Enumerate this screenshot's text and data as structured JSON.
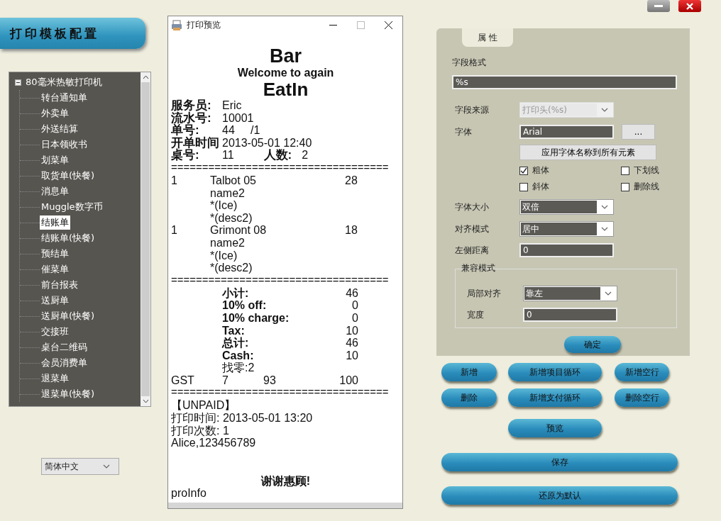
{
  "banner": {
    "title": "打印模板配置"
  },
  "tree": {
    "label": "80毫米热敏打印机",
    "expanded": true,
    "children": [
      {
        "label": "转台通知单",
        "selected": false
      },
      {
        "label": "外卖单",
        "selected": false
      },
      {
        "label": "外送结算",
        "selected": false
      },
      {
        "label": "日本领收书",
        "selected": false
      },
      {
        "label": "划菜单",
        "selected": false
      },
      {
        "label": "取货单(快餐)",
        "selected": false
      },
      {
        "label": "消息单",
        "selected": false
      },
      {
        "label": "Muggle数字币",
        "selected": false
      },
      {
        "label": "结账单",
        "selected": true
      },
      {
        "label": "结账单(快餐)",
        "selected": false
      },
      {
        "label": "预结单",
        "selected": false
      },
      {
        "label": "催菜单",
        "selected": false
      },
      {
        "label": "前台报表",
        "selected": false
      },
      {
        "label": "送厨单",
        "selected": false
      },
      {
        "label": "送厨单(快餐)",
        "selected": false
      },
      {
        "label": "交接班",
        "selected": false
      },
      {
        "label": "桌台二维码",
        "selected": false
      },
      {
        "label": "会员消费单",
        "selected": false
      },
      {
        "label": "退菜单",
        "selected": false
      },
      {
        "label": "退菜单(快餐)",
        "selected": false
      }
    ]
  },
  "language": {
    "value": "简体中文"
  },
  "preview": {
    "title": "打印预览",
    "receipt": {
      "title": "Bar",
      "subtitle": "Welcome to again",
      "order_type": "EatIn",
      "info": [
        {
          "label": "服务员:",
          "value": "Eric"
        },
        {
          "label": "流水号:",
          "value": "10001"
        },
        {
          "label": "单号:",
          "value": "44     /1"
        },
        {
          "label": "开单时间",
          "value": "2013-05-01 12:40"
        },
        {
          "label": "桌号:",
          "value": "11",
          "extra_label": "人数:",
          "extra_value": "2"
        }
      ],
      "separator_1": "===================================",
      "items": [
        {
          "qty": "1",
          "name": "Talbot 05",
          "price": "28",
          "notes": [
            "name2",
            "*(Ice)",
            "*(desc2)"
          ]
        },
        {
          "qty": "1",
          "name": "Grimont 08",
          "price": "18",
          "notes": [
            "name2",
            "*(Ice)",
            "*(desc2)"
          ]
        }
      ],
      "separator_2": "===================================",
      "totals": [
        {
          "kind": "total",
          "label": "小计:",
          "value": "46"
        },
        {
          "kind": "total",
          "label": "10% off:",
          "value": "0"
        },
        {
          "kind": "total",
          "label": "10% charge:",
          "value": "0"
        },
        {
          "kind": "total",
          "label": "Tax:",
          "value": "10"
        },
        {
          "kind": "total",
          "label": "总计:",
          "value": "46"
        },
        {
          "kind": "total",
          "label": "Cash:",
          "value": "10"
        },
        {
          "kind": "note",
          "label": "找零:2"
        }
      ],
      "gst": [
        "GST",
        "7",
        "93",
        "100"
      ],
      "separator_3": "===================================",
      "footer": [
        "【UNPAID】",
        "打印时间: 2013-05-01 13:20",
        "打印次数: 1",
        "Alice,123456789"
      ],
      "thanks": "谢谢惠顾!",
      "pro_info": "proInfo"
    }
  },
  "properties": {
    "tab": "属 性",
    "field_format": {
      "label": "字段格式",
      "value": "%s"
    },
    "source": {
      "label": "字段来源",
      "value": "打印头(%s)",
      "disabled": true
    },
    "font": {
      "label": "字体",
      "value": "Arial",
      "button": "..."
    },
    "apply_font_button": "应用字体名称到所有元素",
    "styles": [
      {
        "label": "粗体",
        "checked": true
      },
      {
        "label": "下划线",
        "checked": false
      },
      {
        "label": "斜体",
        "checked": false
      },
      {
        "label": "删除线",
        "checked": false
      }
    ],
    "rows": [
      {
        "kind": "select",
        "label": "字体大小",
        "value": "双倍"
      },
      {
        "kind": "select",
        "label": "对齐模式",
        "value": "居中"
      },
      {
        "kind": "input",
        "label": "左侧距离",
        "value": "0"
      }
    ],
    "compat": {
      "title": "兼容模式",
      "rows": [
        {
          "kind": "select",
          "label": "局部对齐",
          "value": "靠左"
        },
        {
          "kind": "input",
          "label": "宽度",
          "value": "0"
        }
      ]
    },
    "ok_button": "确定"
  },
  "action_buttons": [
    "新增",
    "新增项目循环",
    "新增空行",
    "删除",
    "新增支付循环",
    "删除空行"
  ],
  "preview_button": "预览",
  "save_button": "保存",
  "reset_button": "还原为默认"
}
